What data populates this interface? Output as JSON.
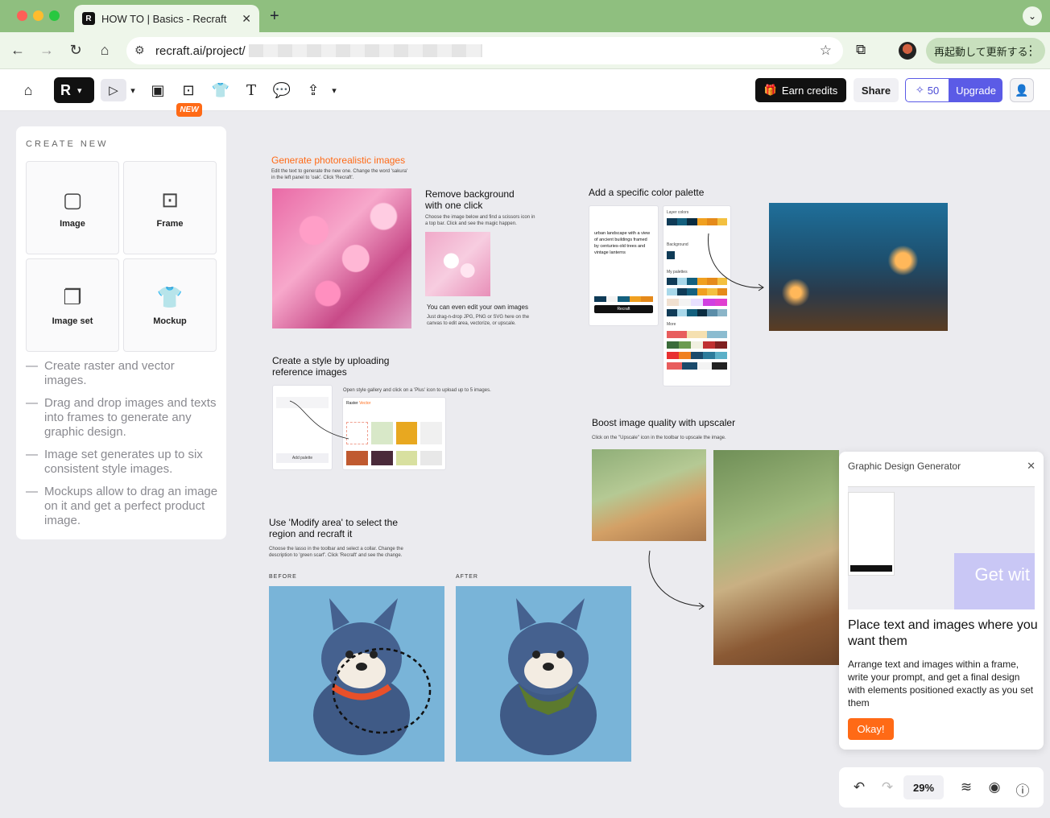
{
  "browser": {
    "tab_title": "HOW TO | Basics - Recraft",
    "url_prefix": "recraft.ai/project/",
    "restart_label": "再起動して更新する"
  },
  "toolbar": {
    "new_badge": "NEW",
    "earn_credits": "Earn credits",
    "share": "Share",
    "credits": "50",
    "upgrade": "Upgrade"
  },
  "left_panel": {
    "title": "CREATE NEW",
    "cards": [
      {
        "label": "Image",
        "icon": "image-icon"
      },
      {
        "label": "Frame",
        "icon": "frame-icon"
      },
      {
        "label": "Image set",
        "icon": "image-set-icon"
      },
      {
        "label": "Mockup",
        "icon": "tshirt-icon"
      }
    ],
    "tips": [
      "Create raster and vector images.",
      "Drag and drop images and texts into frames to generate any graphic design.",
      "Image set generates up to six consistent style images.",
      "Mockups allow to drag an image on it and get a perfect product image."
    ]
  },
  "canvas": {
    "photo": {
      "title": "Generate photorealistic images",
      "desc": "Edit the text to generate the new one. Change the word 'sakura' in the left panel to 'oak'. Click 'Recraft'."
    },
    "removebg": {
      "title": "Remove background with one click",
      "desc": "Choose the image below and find a scissors icon in a top bar. Click and see the magic happen.",
      "own_title": "You can even edit your own images",
      "own_desc": "Just drag-n-drop JPG, PNG or SVG here on the canvas to edit area, vectorize, or upscale."
    },
    "palette": {
      "title": "Add a specific color palette",
      "mock_prompt": "urban landscape with a view of ancient buildings framed by centuries-old trees and vintage lanterns",
      "layer_colors": "Layer colors",
      "background": "Background",
      "my_palettes": "My palettes",
      "more": "More",
      "recraft_btn": "Recraft"
    },
    "style": {
      "title": "Create a style by uploading reference images",
      "desc": "Open style gallery and click on a 'Plus' icon to upload up to 5 images.",
      "add_palette": "Add palette",
      "tab_raster": "Raster",
      "tab_vector": "Vector"
    },
    "upscale": {
      "title": "Boost image quality with upscaler",
      "desc": "Click on the \"Upscale\" icon in the toolbar to upscale the image."
    },
    "modify": {
      "title": "Use 'Modify area' to select the region  and recraft it",
      "desc": "Choose the lasso in the toolbar and select a collar. Change the description to 'green scarf'. Click 'Recraft' and see the change.",
      "before": "BEFORE",
      "after": "AFTER"
    }
  },
  "popup": {
    "title": "Graphic Design Generator",
    "heading": "Place text and images where you want them",
    "body": "Arrange text and images within a frame, write your prompt, and get a final design with elements positioned exactly as you set them",
    "preview_text": "Get wit",
    "okay": "Okay!"
  },
  "bottom": {
    "zoom": "29%"
  },
  "colors": {
    "accent_orange": "#ff6a16",
    "accent_purple": "#5b5be6",
    "tab_green": "#8fbf7f"
  }
}
